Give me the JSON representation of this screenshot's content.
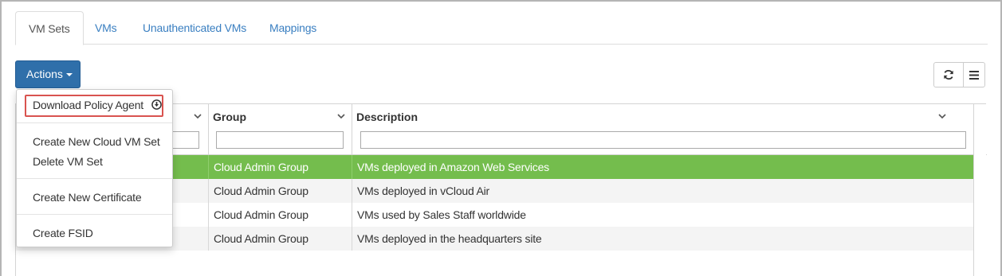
{
  "tabs": [
    {
      "label": "VM Sets",
      "active": true
    },
    {
      "label": "VMs",
      "active": false
    },
    {
      "label": "Unauthenticated VMs",
      "active": false
    },
    {
      "label": "Mappings",
      "active": false
    }
  ],
  "toolbar": {
    "actions_label": "Actions",
    "refresh_icon": "refresh-icon",
    "columns_icon": "list-icon"
  },
  "actions_menu": {
    "items": [
      {
        "label": "Download Policy Agent",
        "icon": "download-circle-icon"
      },
      {
        "label": "Create New Cloud VM Set"
      },
      {
        "label": "Delete VM Set"
      },
      {
        "label": "Create New Certificate"
      },
      {
        "label": "Create FSID"
      }
    ]
  },
  "grid": {
    "columns": [
      {
        "title": ""
      },
      {
        "title": "Group"
      },
      {
        "title": "Description"
      }
    ],
    "rows": [
      {
        "group": "Cloud Admin Group",
        "description": "VMs deployed in Amazon Web Services",
        "selected": true
      },
      {
        "group": "Cloud Admin Group",
        "description": "VMs deployed in vCloud Air",
        "selected": false
      },
      {
        "group": "Cloud Admin Group",
        "description": "VMs used by Sales Staff worldwide",
        "selected": false
      },
      {
        "group": "Cloud Admin Group",
        "description": "VMs deployed in the headquarters site",
        "selected": false
      }
    ]
  },
  "colors": {
    "accent": "#2f6faa",
    "link": "#3a7fc1",
    "selected_row": "#74bd4d",
    "highlight_border": "#d9534f"
  }
}
